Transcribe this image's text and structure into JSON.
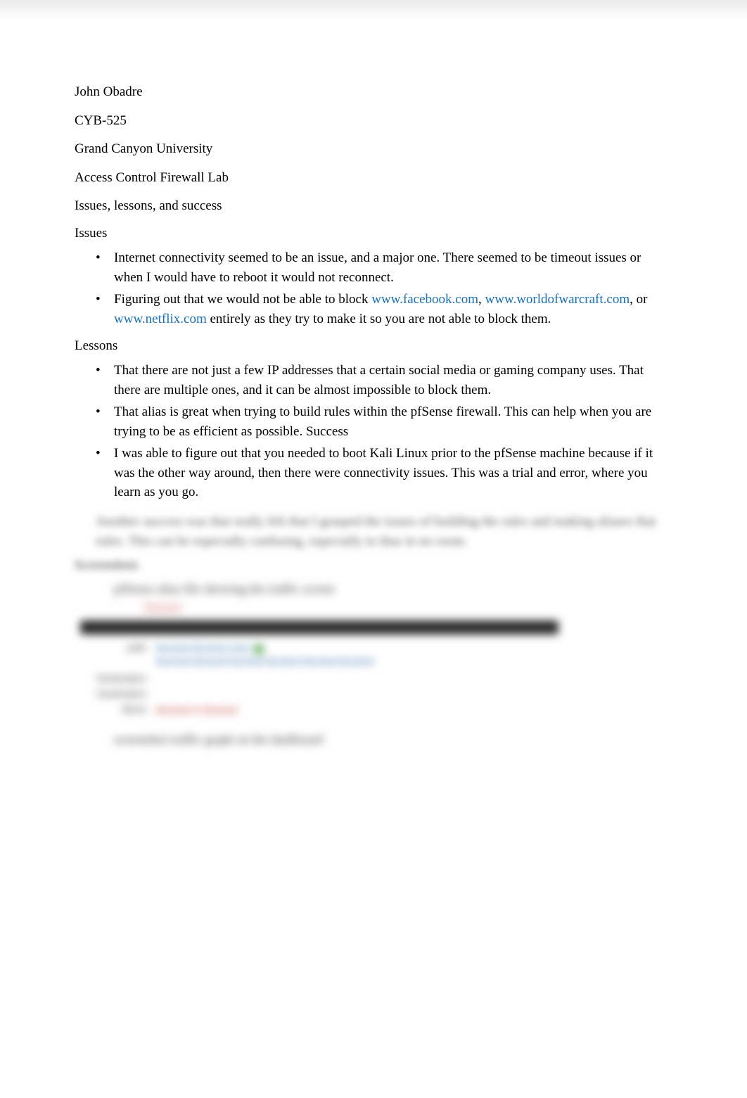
{
  "header": {
    "author": "John Obadre",
    "course": "CYB-525",
    "university": "Grand Canyon University",
    "title": "Access Control Firewall Lab",
    "subtitle": "Issues, lessons, and success"
  },
  "issues": {
    "heading": "Issues",
    "items": [
      {
        "text_before": "Internet connectivity seemed to be an issue, and a major one. There seemed to be timeout issues or when I would have to reboot it would not reconnect."
      },
      {
        "text_before": "Figuring out that we would not be able to block  ",
        "link1": "www.facebook.com",
        "sep1": ", ",
        "link2": "www.worldofwarcraft.com",
        "sep2": ", or ",
        "link3": "www.netflix.com",
        "text_after": " entirely as they try to make it so you are not able to block them."
      }
    ]
  },
  "lessons": {
    "heading": "Lessons",
    "items": [
      "That there are not just a few IP addresses that a certain social media or gaming company uses. That there are multiple ones, and it can be almost impossible to block them.",
      "That alias is great when trying to build rules within the pfSense firewall. This can help when you are trying to be as efficient as possible. Success",
      "I was able to figure out that you needed to boot Kali Linux prior to the pfSense machine because if it was the other way around, then there were connectivity issues. This was a trial and error, where you learn as you go."
    ],
    "blurred_item": "Another success was that really felt that I grasped the issues of building the rules and making aliases that rules. This can be especially confusing, especially to thus in no room."
  },
  "screenshots": {
    "heading": "Screenshots",
    "item1": "pfSense alias file showing the traffic screen",
    "red_small": "blocked",
    "form": {
      "label_path": "path",
      "path_value_line1": "blocked blocked (net)",
      "path_value_line2": "blocked blocked blocked blocked blocked blocked",
      "label_dns": "Destination",
      "label_ip": "Destination",
      "label_block": "Block",
      "block_value": "blocked in blocked"
    },
    "item2": "screenshot traffic graph on the dashboard"
  }
}
